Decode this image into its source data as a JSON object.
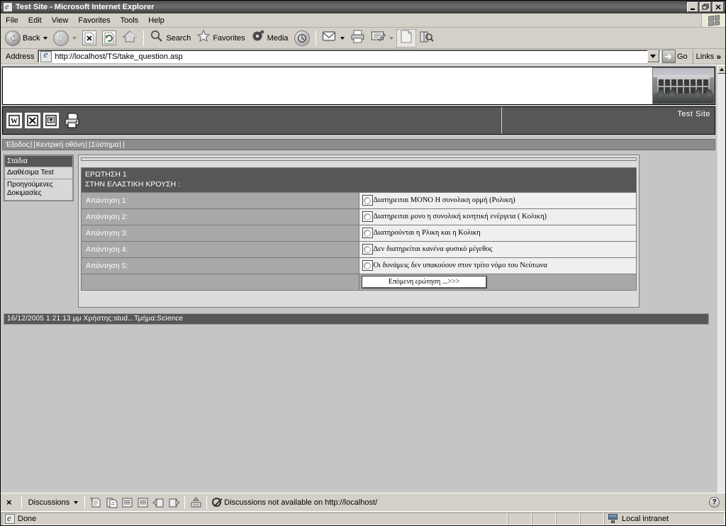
{
  "window": {
    "title": "Test Site - Microsoft Internet Explorer",
    "minimize": "_",
    "maximize": "□",
    "close": "×"
  },
  "menu": {
    "items": [
      "File",
      "Edit",
      "View",
      "Favorites",
      "Tools",
      "Help"
    ]
  },
  "toolbar": {
    "back": "Back",
    "search": "Search",
    "favorites": "Favorites",
    "media": "Media"
  },
  "address": {
    "label": "Address",
    "url": "http://localhost/TS/take_question.asp",
    "go": "Go",
    "links": "Links",
    "chevron": "»"
  },
  "app": {
    "site_name": "Test Site",
    "toolbar_icons": [
      "word-icon",
      "excel-icon",
      "upload-icon",
      "printer-icon"
    ],
    "nav": {
      "links": [
        "Έξοδος",
        "Κεντρική οθόνη",
        "Σύστημα"
      ],
      "separator": "|"
    }
  },
  "sidebar": {
    "header": "Στάδια",
    "items": [
      "Διαθέσιμα Test",
      "Προηγούμενες Δοκιμασίες"
    ]
  },
  "quiz": {
    "question_number": "ΕΡΩΤΗΣΗ 1",
    "question_text": "ΣΤΗΝ ΕΛΑΣΤΙΚΗ ΚΡΟΥΣΗ :",
    "answers": [
      {
        "label": "Απάντηση 1:",
        "text": "Διατηρειται ΜΟΝΟ Η συνολικη ορμή (Ρολικη)",
        "selected": false
      },
      {
        "label": "Απάντηση 2:",
        "text": "Διατηρειται μονο η συνολική κινητική ενέργεια ( Κολικη)",
        "selected": false
      },
      {
        "label": "Απάντηση 3:",
        "text": "Διατηρούνται η Ρλικη και η Κολικη",
        "selected": false
      },
      {
        "label": "Απάντηση 4:",
        "text": "Δεν διατηρείται κανένα φυσικό μέγεθος",
        "selected": false
      },
      {
        "label": "Απάντηση 5:",
        "text": "Οι δυνάμεις δεν υπακούουν στον τρίτο νόμο του Νεύτωνα",
        "selected": false
      }
    ],
    "next_button": "Επόμενη ερώτηση ...>>>"
  },
  "page_status": "16/12/2005 1:21:13 μμ  Χρήστης:stud...Τμήμα:Science",
  "discussions": {
    "close": "×",
    "menu_label": "Discussions",
    "message": "Discussions not available on http://localhost/",
    "help": "?",
    "icons": [
      "insert-discussion-in-document-icon",
      "insert-discussion-about-document-icon",
      "previous-icon",
      "next-icon",
      "reply-icon",
      "refresh-discussions-icon",
      "subscribe-icon"
    ]
  },
  "statusbar": {
    "message": "Done",
    "zone": "Local intranet"
  },
  "colors": {
    "titlebar": "#5a5a5a",
    "chrome": "#d4d0c8",
    "app_dark": "#575757",
    "app_mid": "#8c8c8c",
    "answer_label": "#a8a8a8",
    "answer_bg": "#efefef",
    "page_bg": "#c5c5c5"
  }
}
